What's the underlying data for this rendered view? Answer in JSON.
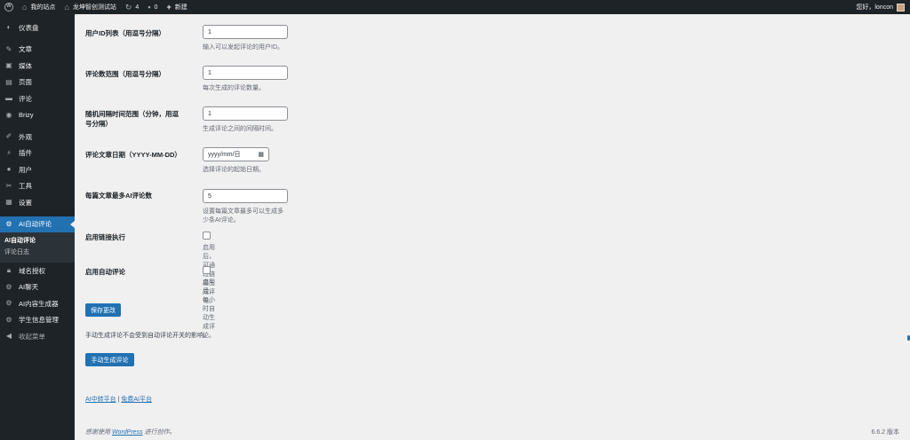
{
  "adminbar": {
    "site_name": "我的站点",
    "site_link": "龙坤智创测试站",
    "updates_count": "4",
    "comments_count": "0",
    "new_label": "新建",
    "greeting": "您好，loncon"
  },
  "sidebar": {
    "items": [
      {
        "label": "仪表盘",
        "icon": "dashboard-icon"
      },
      {
        "label": "文章",
        "icon": "pin-icon"
      },
      {
        "label": "媒体",
        "icon": "media-icon"
      },
      {
        "label": "页面",
        "icon": "page-icon"
      },
      {
        "label": "评论",
        "icon": "comment-icon"
      },
      {
        "label": "Brizy",
        "icon": "brizy-icon"
      },
      {
        "label": "外观",
        "icon": "brush-icon"
      },
      {
        "label": "插件",
        "icon": "plugin-icon"
      },
      {
        "label": "用户",
        "icon": "user-icon"
      },
      {
        "label": "工具",
        "icon": "wrench-icon"
      },
      {
        "label": "设置",
        "icon": "settings-icon"
      },
      {
        "label": "AI自动评论",
        "icon": "gear-icon"
      },
      {
        "label": "域名授权",
        "icon": "lock-icon"
      },
      {
        "label": "AI聊天",
        "icon": "gear-icon"
      },
      {
        "label": "AI内容生成器",
        "icon": "gear-icon"
      },
      {
        "label": "学生信息管理",
        "icon": "gear-icon"
      },
      {
        "label": "收起菜单",
        "icon": "collapse-icon"
      }
    ],
    "submenu": [
      {
        "label": "AI自动评论"
      },
      {
        "label": "评论日志"
      }
    ]
  },
  "form": {
    "user_ids": {
      "label": "用户ID列表（用逗号分隔）",
      "value": "1",
      "desc": "输入可以发起评论的用户ID。"
    },
    "comment_range": {
      "label": "评论数范围（用逗号分隔）",
      "value": "1",
      "desc": "每次生成的评论数量。"
    },
    "interval": {
      "label": "随机间隔时间范围（分钟，用逗号分隔）",
      "value": "1",
      "desc": "生成评论之间的间隔时间。"
    },
    "start_date": {
      "label": "评论文章日期（YYYY-MM-DD）",
      "value": "yyyy/mm/日",
      "desc": "选择评论的起始日期。"
    },
    "max_per_post": {
      "label": "每篇文章最多AI评论数",
      "value": "5",
      "desc": "设置每篇文章最多可以生成多少条AI评论。"
    },
    "link_exec": {
      "label": "启用链接执行",
      "desc": "启用后，可通过链接生成评论。"
    },
    "auto_comment": {
      "label": "启用自动评论",
      "desc": "启用后，每小时自动生成评论。"
    }
  },
  "save_button": "保存更改",
  "manual_note": "手动生成评论不会受到自动评论开关的影响。",
  "manual_button": "手动生成评论",
  "links": {
    "relay": "AI中转平台",
    "separator": "|",
    "free": "免费AI平台"
  },
  "footer": {
    "thanks_prefix": "感谢使用",
    "wordpress": "WordPress",
    "thanks_suffix": "进行创作。",
    "version": "6.6.2 版本"
  }
}
